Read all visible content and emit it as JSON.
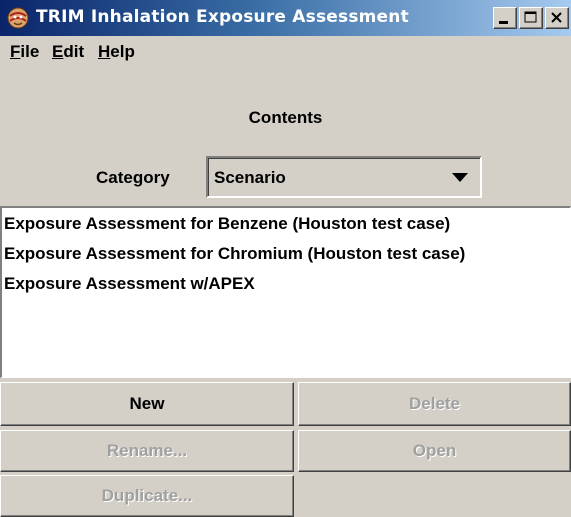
{
  "window": {
    "title": "TRIM Inhalation Exposure Assessment",
    "icon": "trim-app-icon"
  },
  "menu": {
    "file": "File",
    "edit": "Edit",
    "help": "Help"
  },
  "contents": {
    "heading": "Contents",
    "category_label": "Category",
    "category_value": "Scenario"
  },
  "list": {
    "items": [
      "Exposure Assessment for Benzene (Houston test case)",
      "Exposure Assessment for Chromium (Houston test case)",
      "Exposure Assessment w/APEX"
    ]
  },
  "buttons": {
    "new": "New",
    "delete": "Delete",
    "rename": "Rename...",
    "open": "Open",
    "duplicate": "Duplicate..."
  },
  "colors": {
    "title_gradient_start": "#0a246a",
    "title_gradient_end": "#a6caf0",
    "face": "#d4d0c8",
    "disabled_text": "#a0a0a0"
  }
}
